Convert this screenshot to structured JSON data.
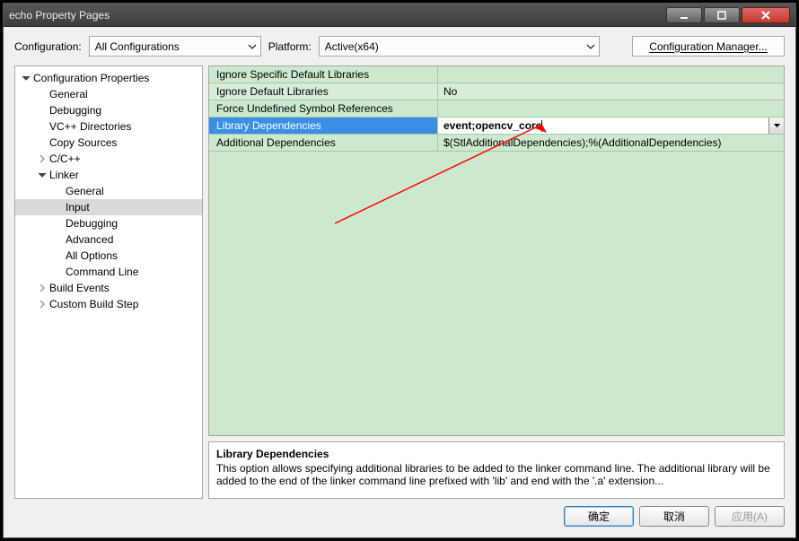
{
  "title": "echo Property Pages",
  "toolbar": {
    "config_label": "Configuration:",
    "config_value": "All Configurations",
    "platform_label": "Platform:",
    "platform_value": "Active(x64)",
    "cfgmgr_label": "Configuration Manager..."
  },
  "tree": {
    "root": "Configuration Properties",
    "items": [
      {
        "label": "General",
        "depth": 2
      },
      {
        "label": "Debugging",
        "depth": 2
      },
      {
        "label": "VC++ Directories",
        "depth": 2
      },
      {
        "label": "Copy Sources",
        "depth": 2
      },
      {
        "label": "C/C++",
        "depth": 2,
        "expand": "closed"
      },
      {
        "label": "Linker",
        "depth": 2,
        "expand": "open"
      },
      {
        "label": "General",
        "depth": 3
      },
      {
        "label": "Input",
        "depth": 3,
        "selected": true
      },
      {
        "label": "Debugging",
        "depth": 3
      },
      {
        "label": "Advanced",
        "depth": 3
      },
      {
        "label": "All Options",
        "depth": 3
      },
      {
        "label": "Command Line",
        "depth": 3
      },
      {
        "label": "Build Events",
        "depth": 2,
        "expand": "closed"
      },
      {
        "label": "Custom Build Step",
        "depth": 2,
        "expand": "closed"
      }
    ]
  },
  "grid": {
    "rows": [
      {
        "name": "Ignore Specific Default Libraries",
        "value": ""
      },
      {
        "name": "Ignore Default Libraries",
        "value": "No"
      },
      {
        "name": "Force Undefined Symbol References",
        "value": ""
      },
      {
        "name": "Library Dependencies",
        "value": "event;opencv_core",
        "selected": true,
        "bold": true,
        "dropdown": true
      },
      {
        "name": "Additional Dependencies",
        "value": "$(StlAdditionalDependencies);%(AdditionalDependencies)"
      }
    ]
  },
  "desc": {
    "title": "Library Dependencies",
    "body": "This option allows specifying additional libraries to be  added to the linker command line. The additional library will be added to the end of the linker command line  prefixed with 'lib' and end with the '.a' extension..."
  },
  "footer": {
    "ok": "确定",
    "cancel": "取消",
    "apply": "应用(A)"
  }
}
